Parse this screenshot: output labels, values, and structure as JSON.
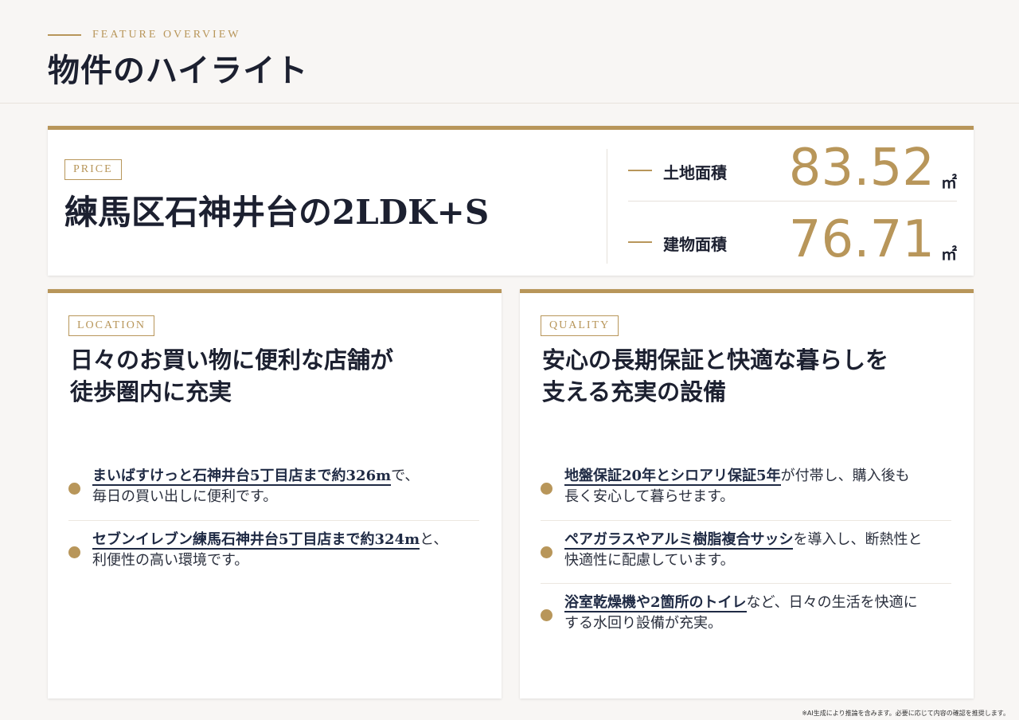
{
  "header": {
    "eyebrow": "FEATURE OVERVIEW",
    "title": "物件のハイライト"
  },
  "price": {
    "tag": "PRICE",
    "title": "練馬区石神井台の2LDK+S",
    "stats": [
      {
        "label": "土地面積",
        "value": "83.52",
        "unit": "㎡"
      },
      {
        "label": "建物面積",
        "value": "76.71",
        "unit": "㎡"
      }
    ]
  },
  "location": {
    "tag": "LOCATION",
    "heading": [
      "日々のお買い物に便利な店舗が",
      "徒歩圏内に充実"
    ],
    "bullets": [
      {
        "highlight": "まいばすけっと石神井台5丁目店まで約326m",
        "line1_rest": "で、",
        "line2": "毎日の買い出しに便利です。"
      },
      {
        "highlight": "セブンイレブン練馬石神井台5丁目店まで約324m",
        "line1_rest": "と、",
        "line2": "利便性の高い環境です。"
      }
    ]
  },
  "quality": {
    "tag": "QUALITY",
    "heading": [
      "安心の長期保証と快適な暮らしを",
      "支える充実の設備"
    ],
    "bullets": [
      {
        "highlight": "地盤保証20年とシロアリ保証5年",
        "line1_rest": "が付帯し、購入後も",
        "line2": "長く安心して暮らせます。"
      },
      {
        "highlight": "ペアガラスやアルミ樹脂複合サッシ",
        "line1_rest": "を導入し、断熱性と",
        "line2": "快適性に配慮しています。"
      },
      {
        "highlight": "浴室乾燥機や2箇所のトイレ",
        "line1_rest": "など、日々の生活を快適に",
        "line2": "する水回り設備が充実。"
      }
    ]
  },
  "footnote": "※AI生成により推論を含みます。必要に応じて内容の確認を推奨します。",
  "colors": {
    "accent": "#b8965a",
    "text": "#1c2030",
    "background": "#f8f6f4"
  }
}
